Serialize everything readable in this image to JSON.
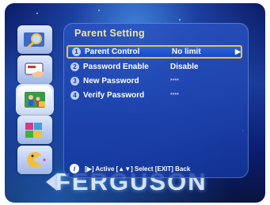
{
  "panel": {
    "title": "Parent Setting"
  },
  "menu": {
    "items": [
      {
        "number": "1",
        "label": "Parent Control",
        "value": "No limit",
        "arrow": "▶"
      },
      {
        "number": "2",
        "label": "Password Enable",
        "value": "Disable",
        "arrow": ""
      },
      {
        "number": "3",
        "label": "New Password",
        "value": "****",
        "arrow": ""
      },
      {
        "number": "4",
        "label": "Verify Password",
        "value": "****",
        "arrow": ""
      }
    ]
  },
  "footer": {
    "info_glyph": "i",
    "help_text": "[▶] Active [▲▼] Select [EXIT] Back"
  },
  "brand": {
    "logo_text": "FERGUSON"
  },
  "side_icons": [
    {
      "icon": "search-icon"
    },
    {
      "icon": "hand-card-icon"
    },
    {
      "icon": "parent-lock-icon"
    },
    {
      "icon": "puzzle-icon"
    },
    {
      "icon": "game-icon"
    }
  ],
  "colors": {
    "title": "#f5e79a",
    "selection_border": "#f1c232",
    "panel": "#2a5ed0"
  }
}
